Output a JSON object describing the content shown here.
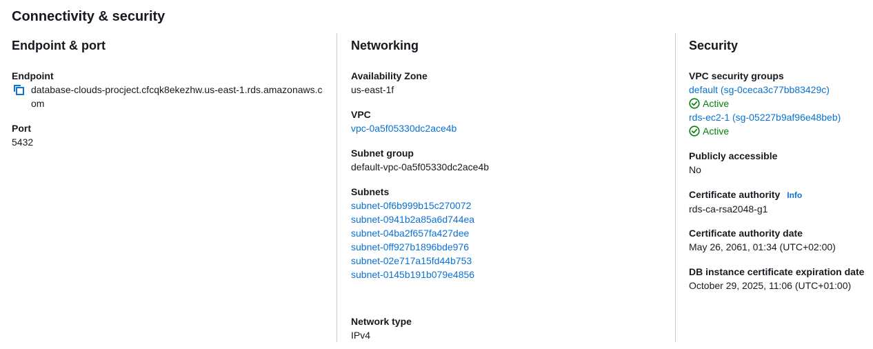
{
  "title": "Connectivity & security",
  "endpoint_section": {
    "heading": "Endpoint & port",
    "endpoint_label": "Endpoint",
    "endpoint_value": "database-clouds-procject.cfcqk8ekezhw.us-east-1.rds.amazonaws.com",
    "port_label": "Port",
    "port_value": "5432",
    "copy_icon": "copy-icon"
  },
  "networking_section": {
    "heading": "Networking",
    "az_label": "Availability Zone",
    "az_value": "us-east-1f",
    "vpc_label": "VPC",
    "vpc_value": "vpc-0a5f05330dc2ace4b",
    "subnet_group_label": "Subnet group",
    "subnet_group_value": "default-vpc-0a5f05330dc2ace4b",
    "subnets_label": "Subnets",
    "subnets": [
      "subnet-0f6b999b15c270072",
      "subnet-0941b2a85a6d744ea",
      "subnet-04ba2f657fa427dee",
      "subnet-0ff927b1896bde976",
      "subnet-02e717a15fd44b753",
      "subnet-0145b191b079e4856"
    ],
    "network_type_label": "Network type",
    "network_type_value": "IPv4"
  },
  "security_section": {
    "heading": "Security",
    "vpc_sg_label": "VPC security groups",
    "security_groups": [
      {
        "name": "default (sg-0ceca3c77bb83429c)",
        "status": "Active"
      },
      {
        "name": "rds-ec2-1 (sg-05227b9af96e48beb)",
        "status": "Active"
      }
    ],
    "status_icon": "check-circle-icon",
    "public_label": "Publicly accessible",
    "public_value": "No",
    "ca_label": "Certificate authority",
    "ca_info": "Info",
    "ca_value": "rds-ca-rsa2048-g1",
    "ca_date_label": "Certificate authority date",
    "ca_date_value": "May 26, 2061, 01:34 (UTC+02:00)",
    "cert_exp_label": "DB instance certificate expiration date",
    "cert_exp_value": "October 29, 2025, 11:06 (UTC+01:00)"
  },
  "colors": {
    "link": "#0972d3",
    "success": "#037f0c",
    "divider": "#c6c6cd",
    "text": "#16191f"
  }
}
